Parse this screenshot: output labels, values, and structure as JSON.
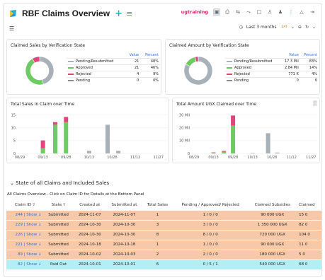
{
  "app": {
    "title": "RBF Claims Overview",
    "plus_icon": "plus-icon",
    "menu_icon": "list-icon",
    "user": "ugtraining",
    "accent": "#1db2c9",
    "user_color": "#d8266a"
  },
  "toolbar_icons": [
    "screenshot-icon",
    "export-icon",
    "share-icon",
    "trend-icon",
    "book-icon",
    "person-icon",
    "people-icon",
    "more-icon",
    "bell-icon",
    "logout-icon"
  ],
  "subbar": {
    "hamburger_icon": "hamburger-icon",
    "time_range": "Last 3 months",
    "timezone": "EAT",
    "zoom_icon": "zoom-out-icon",
    "refresh_icon": "refresh-icon"
  },
  "panels": {
    "sales_by_state": {
      "title": "Claimed Sales by Verification State",
      "headers": [
        "Value",
        "Percent"
      ],
      "rows": [
        {
          "label": "Pending/Resubmitted",
          "value": "21",
          "percent": "48%",
          "color": "#a8b0b8"
        },
        {
          "label": "Approved",
          "value": "21",
          "percent": "46%",
          "color": "#6ecb63"
        },
        {
          "label": "Rejected",
          "value": "4",
          "percent": "9%",
          "color": "#e0457b"
        },
        {
          "label": "Pending",
          "value": "0",
          "percent": "0%",
          "color": "#8c8c8c"
        }
      ]
    },
    "amount_by_state": {
      "title": "Claimed Amount by Verification State",
      "headers": [
        "Value",
        "Percent"
      ],
      "rows": [
        {
          "label": "Pending/Resubmitted",
          "value": "17.3 Mil",
          "percent": "83%",
          "color": "#a8b0b8"
        },
        {
          "label": "Approved",
          "value": "2.84 Mil",
          "percent": "14%",
          "color": "#6ecb63"
        },
        {
          "label": "Rejected",
          "value": "771 K",
          "percent": "4%",
          "color": "#e0457b"
        },
        {
          "label": "Pending",
          "value": "0",
          "percent": "0",
          "color": "#8c8c8c"
        }
      ]
    },
    "sales_over_time": {
      "title": "Total Sales in Claim over Time"
    },
    "amount_over_time": {
      "title": "Total Amount UGX Claimed over Time"
    }
  },
  "chart_data": [
    {
      "type": "pie",
      "title": "Claimed Sales by Verification State",
      "labels": [
        "Pending/Resubmitted",
        "Approved",
        "Rejected",
        "Pending"
      ],
      "values": [
        21,
        21,
        4,
        0
      ]
    },
    {
      "type": "pie",
      "title": "Claimed Amount by Verification State",
      "labels": [
        "Pending/Resubmitted",
        "Approved",
        "Rejected",
        "Pending"
      ],
      "values": [
        17300000,
        2840000,
        771000,
        0
      ]
    },
    {
      "type": "bar",
      "title": "Total Sales in Claim over Time",
      "categories": [
        "08/29",
        "09/13",
        "09/28",
        "10/13",
        "10/28",
        "11/12",
        "11/27"
      ],
      "ylim": [
        0,
        16
      ],
      "yticks": [
        "0",
        "5",
        "10",
        "15"
      ],
      "series": [
        {
          "name": "Pending/Resubmitted",
          "x": [
            "09/13",
            "09/21",
            "09/28",
            "10/13",
            "10/25",
            "11/01"
          ],
          "values": [
            0,
            0,
            0,
            1,
            11,
            1
          ],
          "color": "#a8b0b8"
        },
        {
          "name": "Approved",
          "x": [
            "09/13",
            "09/21",
            "09/28",
            "10/13",
            "10/25",
            "11/01"
          ],
          "values": [
            2,
            11,
            12,
            0,
            0,
            0
          ],
          "color": "#6ecb63"
        },
        {
          "name": "Rejected",
          "x": [
            "09/13",
            "09/21",
            "09/28",
            "10/13",
            "10/25",
            "11/01"
          ],
          "values": [
            3,
            1,
            2,
            0,
            0,
            0
          ],
          "color": "#e0457b"
        }
      ]
    },
    {
      "type": "bar",
      "title": "Total Amount UGX Claimed over Time",
      "categories": [
        "08/29",
        "09/13",
        "09/28",
        "10/13",
        "10/28",
        "11/12",
        "11/27"
      ],
      "ylim": [
        0,
        33000000
      ],
      "yticks": [
        "0",
        "10 Mil",
        "20 Mil",
        "30 Mil"
      ],
      "series": [
        {
          "name": "Pending/Resubmitted",
          "x": [
            "09/13",
            "09/21",
            "09/28",
            "10/13",
            "10/25",
            "11/01"
          ],
          "values": [
            0,
            0,
            0,
            400000,
            16000000,
            700000
          ],
          "color": "#a8b0b8"
        },
        {
          "name": "Approved",
          "x": [
            "09/13",
            "09/21",
            "09/28",
            "10/13",
            "10/25",
            "11/01"
          ],
          "values": [
            300000,
            1300000,
            22000000,
            0,
            0,
            0
          ],
          "color": "#6ecb63"
        },
        {
          "name": "Rejected",
          "x": [
            "09/13",
            "09/21",
            "09/28",
            "10/13",
            "10/25",
            "11/01"
          ],
          "values": [
            500000,
            700000,
            8000000,
            0,
            0,
            0
          ],
          "color": "#e0457b"
        }
      ]
    }
  ],
  "section": {
    "title": "State of all Claims and Included Sales",
    "caption": "All Claims Overview - Click on Claim ID for Details at the Bottom Panel"
  },
  "claims_table": {
    "headers": [
      "Claim ID",
      "State",
      "Created at",
      "Submitted at",
      "Total Sales",
      "Pending / Approved/ Rejected",
      "Claimed Subsidies",
      "Claimed"
    ],
    "rows": [
      {
        "id": "244 | Show ↓",
        "state": "Submitted",
        "created": "2024-11-07",
        "submitted": "2024-11-07",
        "total": "1",
        "par": "1 / 0 / 0",
        "subsidies": "90 000 UGX",
        "claimed": "15 0",
        "kind": "submitted"
      },
      {
        "id": "229 | Show ↓",
        "state": "Submitted",
        "created": "2024-10-30",
        "submitted": "2024-10-30",
        "total": "3",
        "par": "3 / 0 / 0",
        "subsidies": "1 350 000 UGX",
        "claimed": "82 0",
        "kind": "submitted"
      },
      {
        "id": "226 | Show ↓",
        "state": "Submitted",
        "created": "2024-10-30",
        "submitted": "2024-10-30",
        "total": "8",
        "par": "8 / 0 / 0",
        "subsidies": "720 000 UGX",
        "claimed": "104 0",
        "kind": "submitted"
      },
      {
        "id": "221 | Show ↓",
        "state": "Submitted",
        "created": "2024-10-18",
        "submitted": "2024-10-18",
        "total": "1",
        "par": "1 / 0 / 0",
        "subsidies": "90 000 UGX",
        "claimed": "11 0",
        "kind": "submitted"
      },
      {
        "id": "89 | Show ↓",
        "state": "Submitted",
        "created": "2024-10-02",
        "submitted": "2024-10-03",
        "total": "2",
        "par": "2 / 0 / 0",
        "subsidies": "180 000 UGX",
        "claimed": "5 0",
        "kind": "submitted"
      },
      {
        "id": "82 | Show ↓",
        "state": "Paid Out",
        "created": "2024-10-01",
        "submitted": "2024-10-01",
        "total": "6",
        "par": "0 / 5 / 1",
        "subsidies": "540 000 UGX",
        "claimed": "68 0",
        "kind": "paid"
      }
    ]
  }
}
